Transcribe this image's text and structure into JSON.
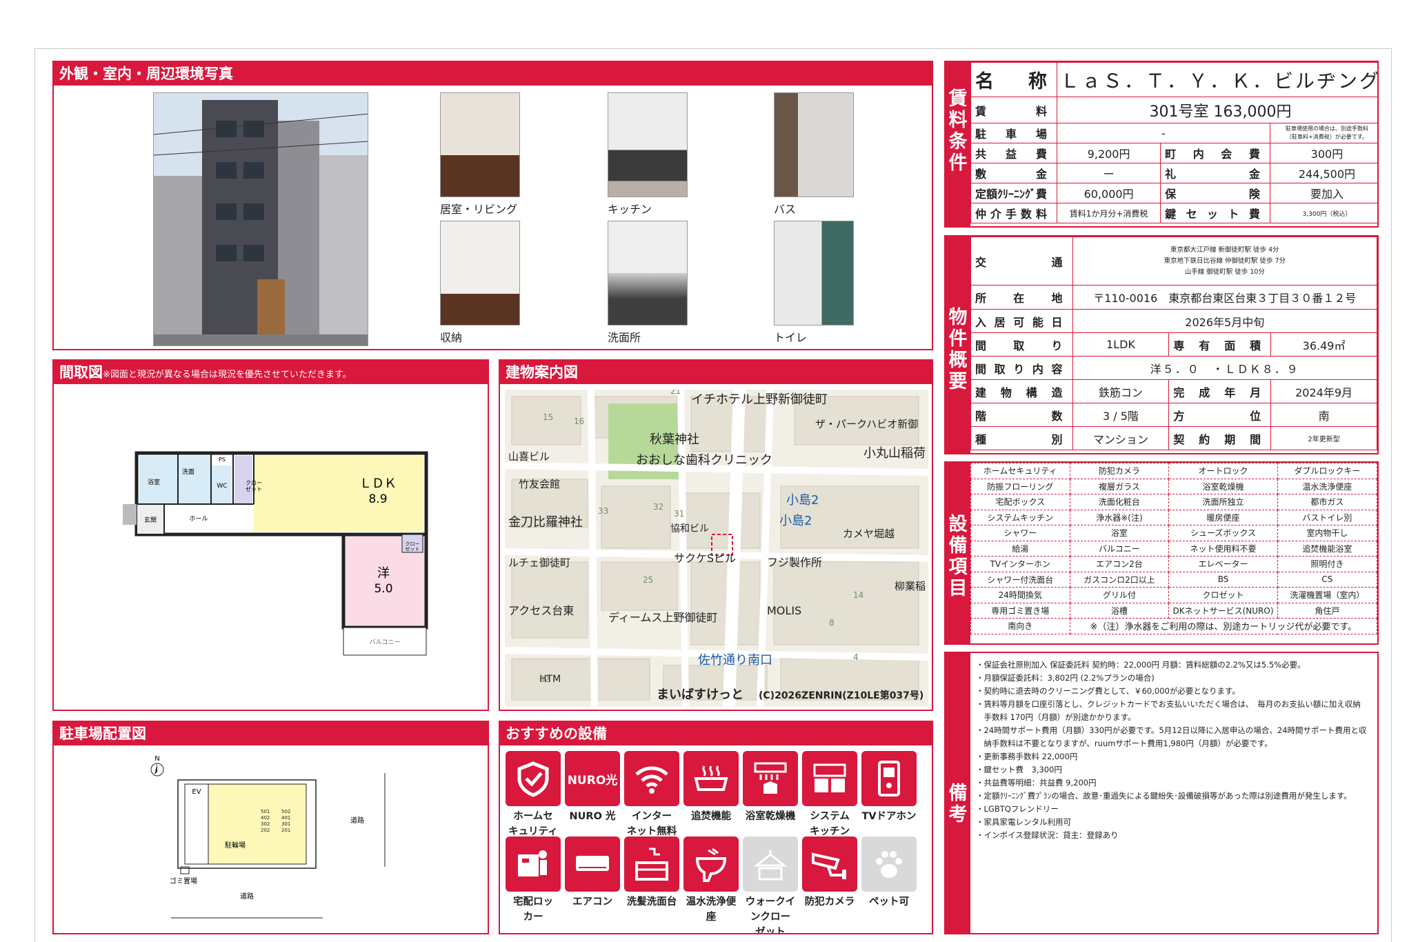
{
  "photos": {
    "title": "外観・室内・周辺環境写真",
    "captions": [
      "居室・リビング",
      "キッチン",
      "バス",
      "収納",
      "洗面所",
      "トイレ"
    ]
  },
  "floorplan": {
    "title": "間取図",
    "note": "※図面と現況が異なる場合は現況を優先させていただきます。",
    "rooms": {
      "ldk": "ＬＤＫ",
      "ldk_size": "8.9",
      "western": "洋",
      "western_size": "5.0",
      "bath": "浴室",
      "washroom": "洗面",
      "wc": "WC",
      "closet": "クロー\nゼット",
      "closet2": "クロー\nゼット",
      "ps": "PS",
      "entrance": "玄関",
      "hall": "ホール",
      "balcony": "バルコニー"
    }
  },
  "map": {
    "title": "建物案内図",
    "labels": [
      "イチホテル上野新御徒町",
      "ザ・パークハビオ新御",
      "秋葉神社",
      "おおしな歯科クリニック",
      "山喜ビル",
      "竹友会館",
      "小島2",
      "小島2",
      "小丸山稲荷",
      "金刀比羅神社",
      "協和ビル",
      "カメヤ堀越",
      "ルチェ御徒町",
      "サクケSビル",
      "フジ製作所",
      "柳業稲",
      "アクセス台東",
      "ディームス上野御徒町",
      "MOLIS",
      "佐竹通り南口",
      "HTM",
      "まいばすけっと",
      "(C)2026ZENRIN(Z10LE第037号)"
    ],
    "numbers": [
      "21",
      "15",
      "16",
      "33",
      "32",
      "31",
      "25",
      "14",
      "8",
      "4",
      "32"
    ]
  },
  "parking": {
    "title": "駐車場配置図",
    "north": "N",
    "ev": "EV",
    "bike": "駐輪場",
    "garbage": "ゴミ置場",
    "road_right": "道路",
    "road_bottom": "道路",
    "units": [
      "501",
      "502",
      "402",
      "401",
      "302",
      "301",
      "202",
      "201"
    ]
  },
  "features": {
    "title": "おすすめの設備",
    "items": [
      {
        "label": "ホームセ\nキュリティ",
        "icon": "shield-icon",
        "on": true
      },
      {
        "label": "NURO 光",
        "icon": "nuro-icon",
        "on": true
      },
      {
        "label": "インター\nネット無料",
        "icon": "wifi-icon",
        "on": true
      },
      {
        "label": "追焚機能",
        "icon": "bathtub-icon",
        "on": true
      },
      {
        "label": "浴室乾燥機",
        "icon": "dryer-icon",
        "on": true
      },
      {
        "label": "システム\nキッチン",
        "icon": "kitchen-icon",
        "on": true
      },
      {
        "label": "TVドアホン",
        "icon": "intercom-icon",
        "on": true
      },
      {
        "label": "宅配ロッ\nカー",
        "icon": "locker-icon",
        "on": true
      },
      {
        "label": "エアコン",
        "icon": "aircon-icon",
        "on": true
      },
      {
        "label": "洗髪洗面台",
        "icon": "washbasin-icon",
        "on": true
      },
      {
        "label": "温水洗浄便\n座",
        "icon": "toilet-icon",
        "on": true
      },
      {
        "label": "ウォークイ\nンクロー\nゼット",
        "icon": "closet-icon",
        "on": false
      },
      {
        "label": "防犯カメラ",
        "icon": "camera-icon",
        "on": true
      },
      {
        "label": "ペット可",
        "icon": "paw-icon",
        "on": false
      }
    ],
    "nuro_text": "NURO光"
  },
  "rent": {
    "side": "賃料条件",
    "name_label": "名称",
    "name": "ＬａＳ．Ｔ．Ｙ．Ｋ．ビルヂング",
    "rent_label": "賃料",
    "rent": "301号室 163,000円",
    "parking_label": "駐車場",
    "parking": "-",
    "parking_note": "駐車場使用の場合は、別途手数料\n（駐車料+消費税）が必要です。",
    "common_label": "共益費",
    "common": "9,200円",
    "town_label": "町内会費",
    "town": "300円",
    "deposit_label": "敷金",
    "deposit": "ー",
    "key_money_label": "礼金",
    "key_money": "244,500円",
    "cleaning_label": "定額ｸﾘｰﾆﾝｸﾞ費",
    "cleaning": "60,000円",
    "insurance_label": "保険",
    "insurance": "要加入",
    "brokerage_label": "仲介手数料",
    "brokerage": "賃料1か月分+消費税",
    "key_set_label": "鍵セット費",
    "key_set": "3,300円（税込）"
  },
  "property": {
    "side": "物件概要",
    "access_label": "交通",
    "access": [
      "東京都大江戸線 新御徒町駅 徒歩 4分",
      "東京地下鉄日比谷線 仲御徒町駅 徒歩 7分",
      "山手線 御徒町駅 徒歩 10分"
    ],
    "address_label": "所在地",
    "address": "〒110-0016　東京都台東区台東３丁目３０番１２号",
    "movein_label": "入居可能日",
    "movein": "2026年5月中旬",
    "layout_label": "間取り",
    "layout": "1LDK",
    "area_label": "専有面積",
    "area": "36.49㎡",
    "layout_detail_label": "間取り内容",
    "layout_detail": "洋５．０　・ＬＤＫ８．９",
    "structure_label": "建物構造",
    "structure": "鉄筋コン",
    "built_label": "完成年月",
    "built": "2024年9月",
    "floor_label": "階数",
    "floor": "3 / 5階",
    "direction_label": "方位",
    "direction": "南",
    "type_label": "種別",
    "type": "マンション",
    "contract_label": "契約期間",
    "contract": "2年更新型"
  },
  "equipment": {
    "side": "設備項目",
    "rows": [
      [
        "ホームセキュリティ",
        "防犯カメラ",
        "オートロック",
        "ダブルロックキー"
      ],
      [
        "防振フローリング",
        "複層ガラス",
        "浴室乾燥機",
        "温水洗浄便座"
      ],
      [
        "宅配ボックス",
        "洗面化粧台",
        "洗面所独立",
        "都市ガス"
      ],
      [
        "システムキッチン",
        "浄水器※(注)",
        "暖房便座",
        "バストイレ別"
      ],
      [
        "シャワー",
        "浴室",
        "シューズボックス",
        "室内物干し"
      ],
      [
        "給湯",
        "バルコニー",
        "ネット使用料不要",
        "追焚機能浴室"
      ],
      [
        "TVインターホン",
        "エアコン2台",
        "エレベーター",
        "照明付き"
      ],
      [
        "シャワー付洗面台",
        "ガスコンロ2口以上",
        "BS",
        "CS"
      ],
      [
        "24時間換気",
        "グリル付",
        "クロゼット",
        "洗濯機置場（室内）"
      ],
      [
        "専用ゴミ置き場",
        "浴槽",
        "DKネットサービス(NURO)",
        "角住戸"
      ]
    ],
    "last_first": "南向き",
    "last_note": "※（注）浄水器をご利用の際は、別途カートリッジ代が必要です。"
  },
  "remarks": {
    "side": "備考",
    "lines": [
      "・保証会社原則加入 保証委託料 契約時：22,000円 月額：賃料総額の2.2%又は5.5%必要。",
      "・月額保証委託料：3,802円 (2.2%プランの場合)",
      "・契約時に退去時のクリーニング費として、￥60,000が必要となります。",
      "・賃料等月額を口座引落とし、クレジットカードでお支払いいただく場合は、　毎月のお支払い額に加え収納\n　手数料 170円（月額）が別途かかります。",
      "・24時間サポート費用（月額）330円が必要です。5月12日以降に入居申込の場合、24時間サポート費用と収\n　納手数料は不要となりますが、ruumサポート費用1,980円（月額）が必要です。",
      "・更新事務手数料 22,000円",
      "・鍵セット費　3,300円",
      "・共益費等明細：共益費 9,200円",
      "・定額ｸﾘｰﾆﾝｸﾞ費ﾌﾟﾗﾝの場合、故意･重過失による鍵紛失･設備破損等があった際は別途費用が発生します。",
      "・LGBTQフレンドリー",
      "・家具家電レンタル利用可",
      "・インボイス登録状況：貸主：登録あり"
    ]
  }
}
